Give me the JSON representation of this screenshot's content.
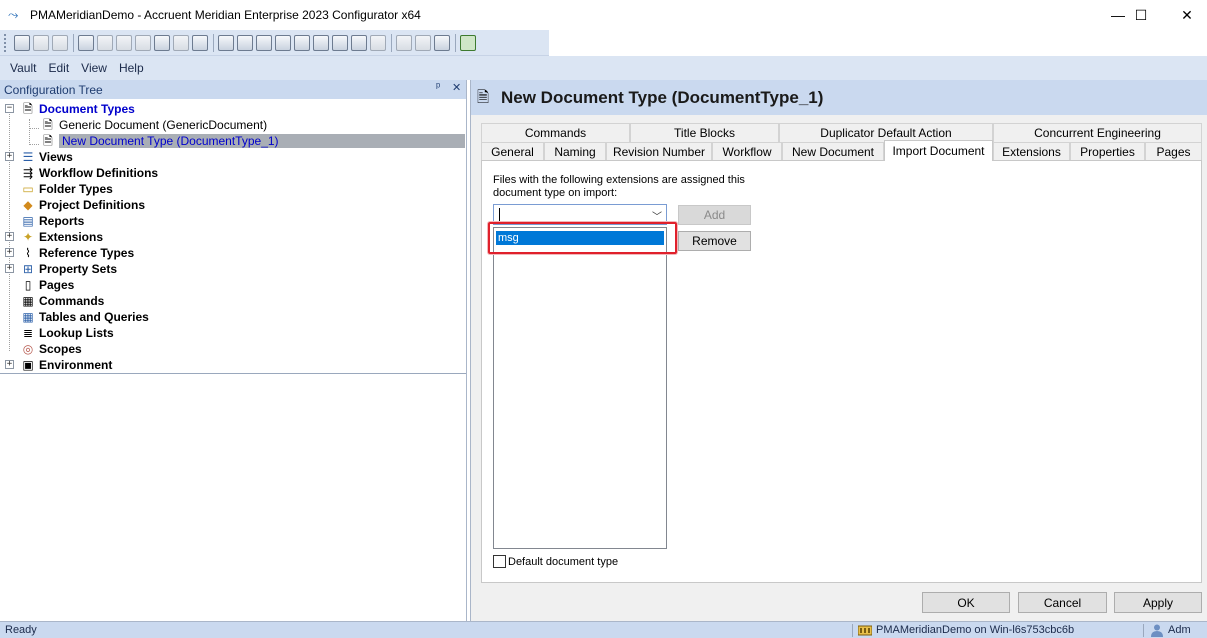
{
  "window": {
    "title": "PMAMeridianDemo - Accruent Meridian Enterprise 2023 Configurator x64",
    "icons": {
      "app": "meridian-app-icon",
      "minimize": "minimize-icon",
      "maximize": "maximize-icon",
      "close": "close-icon"
    },
    "glyphs": {
      "minimize": "—",
      "maximize": "☐",
      "close": "✕"
    }
  },
  "toolbar": {
    "icons": [
      "vault-icon",
      "save-icon",
      "refresh-icon",
      "document-type-icon",
      "views-icon",
      "workflow-icon",
      "folder-icon",
      "project-icon",
      "reports-icon",
      "extensions-icon",
      "reference-icon",
      "property-set-icon",
      "pages-icon",
      "commands-icon",
      "tables-icon",
      "lookup-icon",
      "scopes-icon",
      "environment-icon",
      "edit-icon",
      "copy-icon",
      "paste-icon",
      "delete-icon",
      "help-icon"
    ]
  },
  "menu": {
    "items": [
      {
        "label": "Vault"
      },
      {
        "label": "Edit"
      },
      {
        "label": "View"
      },
      {
        "label": "Help"
      }
    ]
  },
  "config_tree": {
    "header": "Configuration Tree",
    "header_icons": [
      "pin-icon",
      "close-icon"
    ],
    "header_glyphs": [
      "ᵖ",
      "✕"
    ],
    "expand_glyph": "+",
    "collapse_glyph": "−",
    "items": [
      {
        "label": "Document Types",
        "icon": "document-types-icon",
        "glyph": "🗎"
      },
      {
        "label": "Generic Document (GenericDocument)",
        "icon": "document-icon",
        "glyph": "🗎"
      },
      {
        "label": "New Document Type (DocumentType_1)",
        "icon": "document-icon",
        "glyph": "🗎"
      },
      {
        "label": "Views",
        "icon": "views-icon",
        "glyph": "☰"
      },
      {
        "label": "Workflow Definitions",
        "icon": "workflow-icon",
        "glyph": "⇶"
      },
      {
        "label": "Folder Types",
        "icon": "folder-icon",
        "glyph": "▭"
      },
      {
        "label": "Project Definitions",
        "icon": "project-icon",
        "glyph": "◆"
      },
      {
        "label": "Reports",
        "icon": "reports-icon",
        "glyph": "▤"
      },
      {
        "label": "Extensions",
        "icon": "extensions-icon",
        "glyph": "✦"
      },
      {
        "label": "Reference Types",
        "icon": "reference-icon",
        "glyph": "⌇"
      },
      {
        "label": "Property Sets",
        "icon": "property-set-icon",
        "glyph": "⊞"
      },
      {
        "label": "Pages",
        "icon": "pages-icon",
        "glyph": "▯"
      },
      {
        "label": "Commands",
        "icon": "commands-icon",
        "glyph": "▦"
      },
      {
        "label": "Tables and Queries",
        "icon": "tables-icon",
        "glyph": "▦"
      },
      {
        "label": "Lookup Lists",
        "icon": "lookup-icon",
        "glyph": "≣"
      },
      {
        "label": "Scopes",
        "icon": "scopes-icon",
        "glyph": "◎"
      },
      {
        "label": "Environment",
        "icon": "environment-icon",
        "glyph": "▣"
      }
    ]
  },
  "editor": {
    "title": "New Document Type (DocumentType_1)",
    "title_icon": "document-type-icon",
    "title_glyph": "🗎",
    "tabs_row1": [
      {
        "label": "Commands"
      },
      {
        "label": "Title Blocks"
      },
      {
        "label": "Duplicator Default Action"
      },
      {
        "label": "Concurrent Engineering"
      }
    ],
    "tabs_row2": [
      {
        "label": "General"
      },
      {
        "label": "Naming"
      },
      {
        "label": "Revision Number"
      },
      {
        "label": "Workflow"
      },
      {
        "label": "New Document"
      },
      {
        "label": "Import Document"
      },
      {
        "label": "Extensions"
      },
      {
        "label": "Properties"
      },
      {
        "label": "Pages"
      }
    ],
    "active_tab": "Import Document",
    "import": {
      "description": "Files with the following extensions are assigned this document type on import:",
      "combo_value": "",
      "combo_arrow": "﹀",
      "extensions": [
        "msg"
      ],
      "add_label": "Add",
      "remove_label": "Remove",
      "default_checkbox_label": "Default document type"
    },
    "buttons": {
      "ok": "OK",
      "cancel": "Cancel",
      "apply": "Apply"
    }
  },
  "status": {
    "text": "Ready",
    "server": "PMAMeridianDemo on Win-l6s753cbc6b",
    "user": "Adm",
    "server_icon": "server-icon",
    "user_icon": "user-icon"
  },
  "colors": {
    "header_bg": "#cad9ef",
    "toolbar_bg": "#dbe5f3",
    "selection": "#0078d7",
    "highlight_box": "#e0202b",
    "tree_blue": "#0000cc"
  }
}
